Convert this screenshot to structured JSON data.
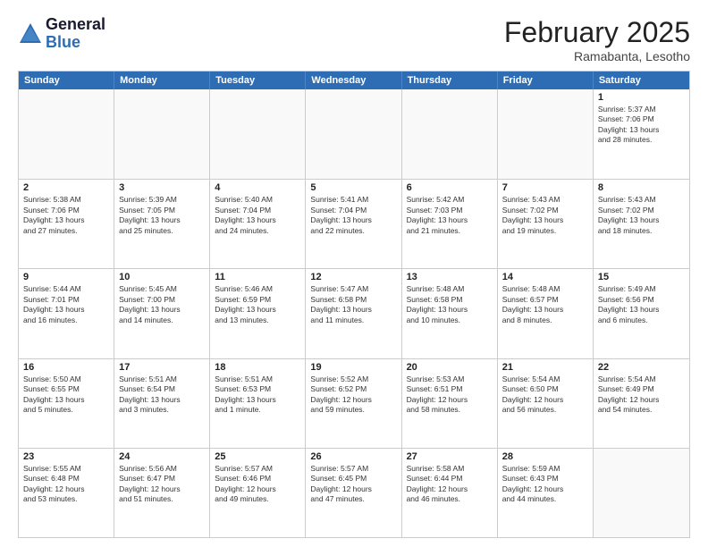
{
  "header": {
    "logo_line1": "General",
    "logo_line2": "Blue",
    "month_title": "February 2025",
    "location": "Ramabanta, Lesotho"
  },
  "weekdays": [
    "Sunday",
    "Monday",
    "Tuesday",
    "Wednesday",
    "Thursday",
    "Friday",
    "Saturday"
  ],
  "rows": [
    [
      {
        "day": "",
        "info": ""
      },
      {
        "day": "",
        "info": ""
      },
      {
        "day": "",
        "info": ""
      },
      {
        "day": "",
        "info": ""
      },
      {
        "day": "",
        "info": ""
      },
      {
        "day": "",
        "info": ""
      },
      {
        "day": "1",
        "info": "Sunrise: 5:37 AM\nSunset: 7:06 PM\nDaylight: 13 hours\nand 28 minutes."
      }
    ],
    [
      {
        "day": "2",
        "info": "Sunrise: 5:38 AM\nSunset: 7:06 PM\nDaylight: 13 hours\nand 27 minutes."
      },
      {
        "day": "3",
        "info": "Sunrise: 5:39 AM\nSunset: 7:05 PM\nDaylight: 13 hours\nand 25 minutes."
      },
      {
        "day": "4",
        "info": "Sunrise: 5:40 AM\nSunset: 7:04 PM\nDaylight: 13 hours\nand 24 minutes."
      },
      {
        "day": "5",
        "info": "Sunrise: 5:41 AM\nSunset: 7:04 PM\nDaylight: 13 hours\nand 22 minutes."
      },
      {
        "day": "6",
        "info": "Sunrise: 5:42 AM\nSunset: 7:03 PM\nDaylight: 13 hours\nand 21 minutes."
      },
      {
        "day": "7",
        "info": "Sunrise: 5:43 AM\nSunset: 7:02 PM\nDaylight: 13 hours\nand 19 minutes."
      },
      {
        "day": "8",
        "info": "Sunrise: 5:43 AM\nSunset: 7:02 PM\nDaylight: 13 hours\nand 18 minutes."
      }
    ],
    [
      {
        "day": "9",
        "info": "Sunrise: 5:44 AM\nSunset: 7:01 PM\nDaylight: 13 hours\nand 16 minutes."
      },
      {
        "day": "10",
        "info": "Sunrise: 5:45 AM\nSunset: 7:00 PM\nDaylight: 13 hours\nand 14 minutes."
      },
      {
        "day": "11",
        "info": "Sunrise: 5:46 AM\nSunset: 6:59 PM\nDaylight: 13 hours\nand 13 minutes."
      },
      {
        "day": "12",
        "info": "Sunrise: 5:47 AM\nSunset: 6:58 PM\nDaylight: 13 hours\nand 11 minutes."
      },
      {
        "day": "13",
        "info": "Sunrise: 5:48 AM\nSunset: 6:58 PM\nDaylight: 13 hours\nand 10 minutes."
      },
      {
        "day": "14",
        "info": "Sunrise: 5:48 AM\nSunset: 6:57 PM\nDaylight: 13 hours\nand 8 minutes."
      },
      {
        "day": "15",
        "info": "Sunrise: 5:49 AM\nSunset: 6:56 PM\nDaylight: 13 hours\nand 6 minutes."
      }
    ],
    [
      {
        "day": "16",
        "info": "Sunrise: 5:50 AM\nSunset: 6:55 PM\nDaylight: 13 hours\nand 5 minutes."
      },
      {
        "day": "17",
        "info": "Sunrise: 5:51 AM\nSunset: 6:54 PM\nDaylight: 13 hours\nand 3 minutes."
      },
      {
        "day": "18",
        "info": "Sunrise: 5:51 AM\nSunset: 6:53 PM\nDaylight: 13 hours\nand 1 minute."
      },
      {
        "day": "19",
        "info": "Sunrise: 5:52 AM\nSunset: 6:52 PM\nDaylight: 12 hours\nand 59 minutes."
      },
      {
        "day": "20",
        "info": "Sunrise: 5:53 AM\nSunset: 6:51 PM\nDaylight: 12 hours\nand 58 minutes."
      },
      {
        "day": "21",
        "info": "Sunrise: 5:54 AM\nSunset: 6:50 PM\nDaylight: 12 hours\nand 56 minutes."
      },
      {
        "day": "22",
        "info": "Sunrise: 5:54 AM\nSunset: 6:49 PM\nDaylight: 12 hours\nand 54 minutes."
      }
    ],
    [
      {
        "day": "23",
        "info": "Sunrise: 5:55 AM\nSunset: 6:48 PM\nDaylight: 12 hours\nand 53 minutes."
      },
      {
        "day": "24",
        "info": "Sunrise: 5:56 AM\nSunset: 6:47 PM\nDaylight: 12 hours\nand 51 minutes."
      },
      {
        "day": "25",
        "info": "Sunrise: 5:57 AM\nSunset: 6:46 PM\nDaylight: 12 hours\nand 49 minutes."
      },
      {
        "day": "26",
        "info": "Sunrise: 5:57 AM\nSunset: 6:45 PM\nDaylight: 12 hours\nand 47 minutes."
      },
      {
        "day": "27",
        "info": "Sunrise: 5:58 AM\nSunset: 6:44 PM\nDaylight: 12 hours\nand 46 minutes."
      },
      {
        "day": "28",
        "info": "Sunrise: 5:59 AM\nSunset: 6:43 PM\nDaylight: 12 hours\nand 44 minutes."
      },
      {
        "day": "",
        "info": ""
      }
    ]
  ]
}
